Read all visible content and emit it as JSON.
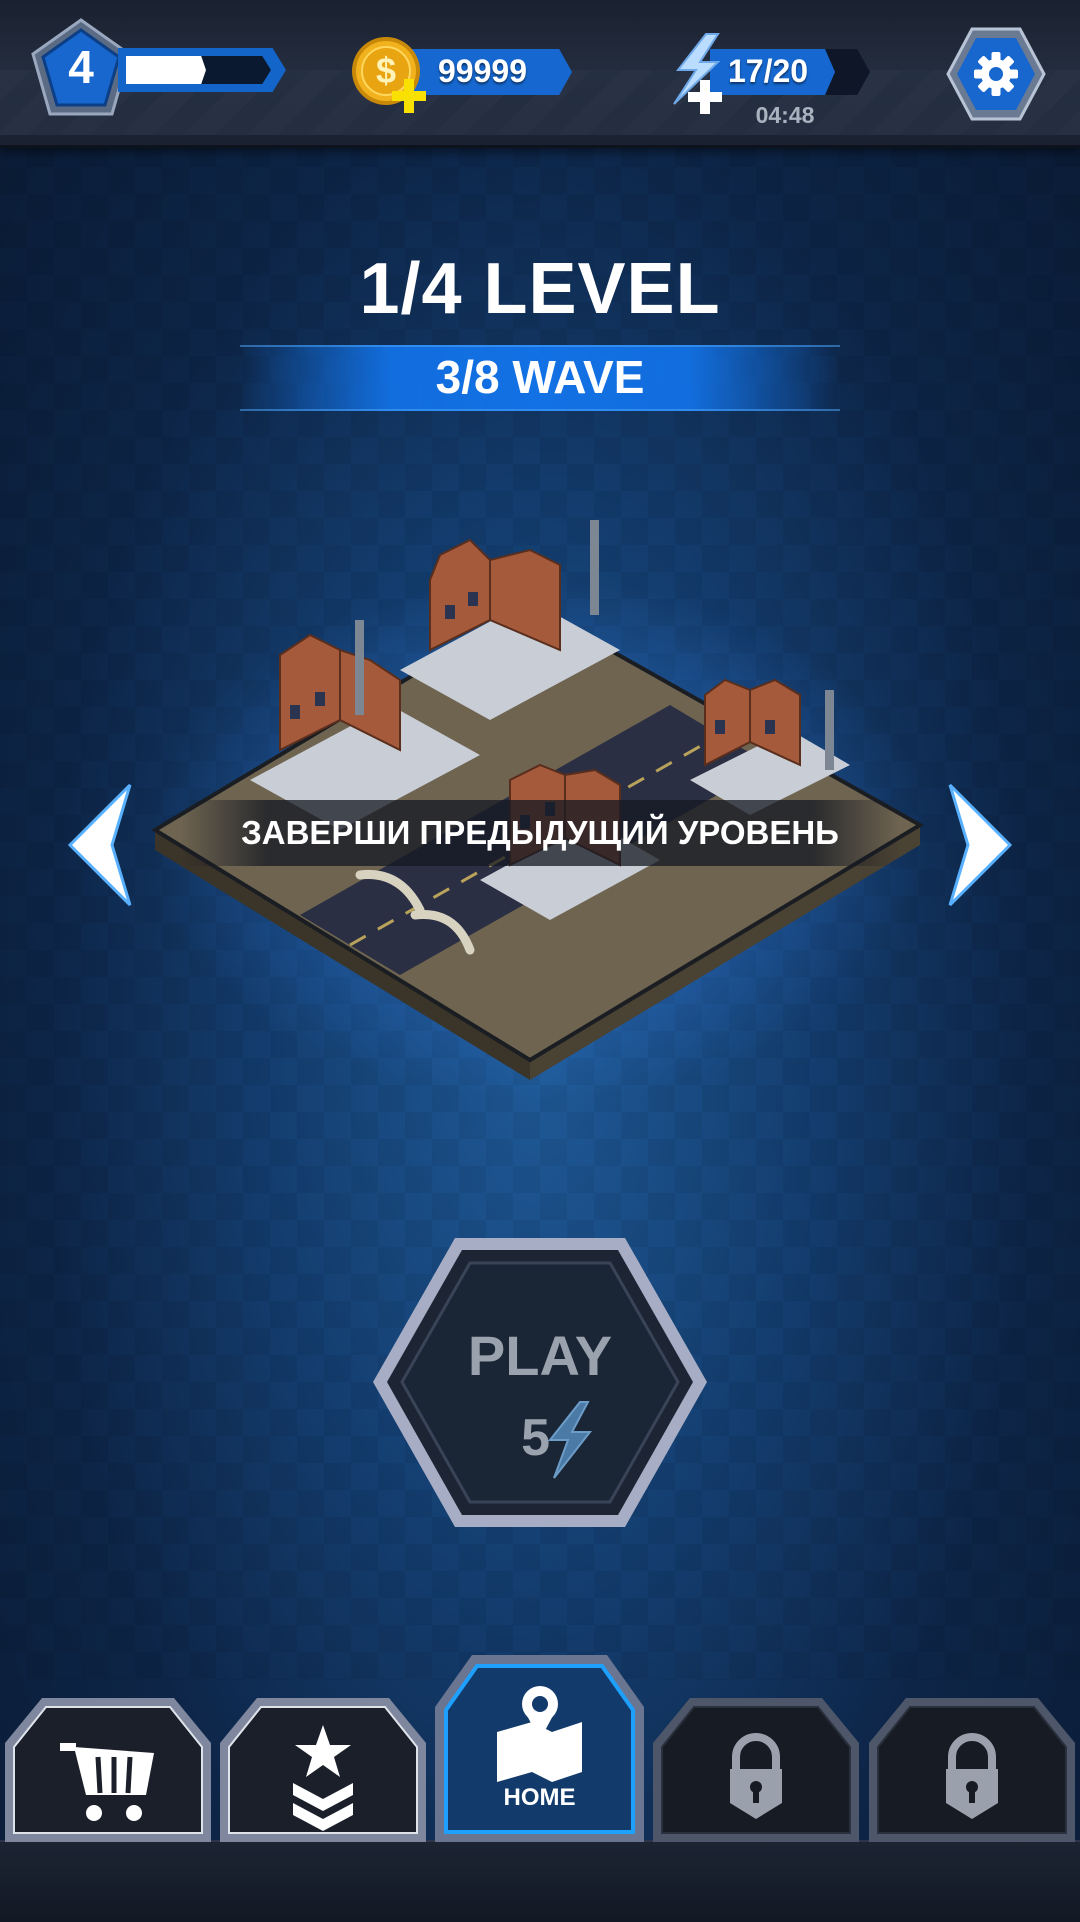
{
  "header": {
    "player_level": "4",
    "xp_progress": 0.55,
    "coins": "99999",
    "energy": "17/20",
    "energy_timer": "04:48"
  },
  "level_info": {
    "level_title": "1/4 LEVEL",
    "wave_title": "3/8 WAVE"
  },
  "map": {
    "locked_message": "ЗАВЕРШИ ПРЕДЫДУЩИЙ УРОВЕНЬ"
  },
  "play_button": {
    "label": "PLAY",
    "cost": "5",
    "enabled": false
  },
  "bottom_nav": {
    "tabs": [
      {
        "icon": "cart-icon",
        "label": ""
      },
      {
        "icon": "rank-chevron-star-icon",
        "label": ""
      },
      {
        "icon": "map-pin-icon",
        "label": "HOME",
        "active": true
      },
      {
        "icon": "padlock-icon",
        "label": "",
        "locked": true
      },
      {
        "icon": "padlock-icon",
        "label": "",
        "locked": true
      }
    ]
  },
  "colors": {
    "accent_blue": "#1668d0",
    "gold": "#f2b21e",
    "background": "#143e70",
    "active_tab_border": "#1ea0ff"
  }
}
